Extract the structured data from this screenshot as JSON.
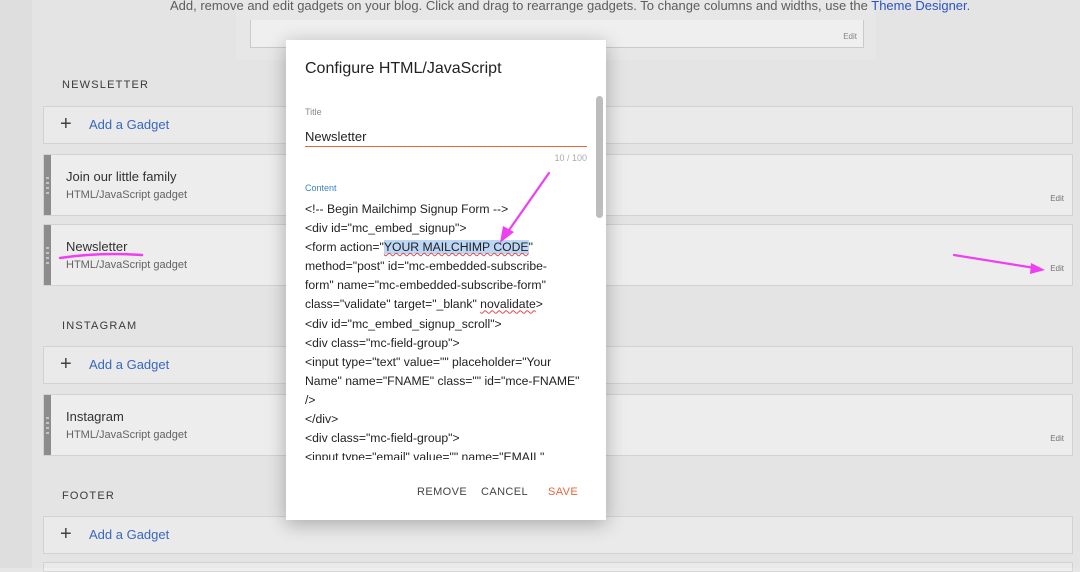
{
  "page": {
    "description": "Add, remove and edit gadgets on your blog. Click and drag to rearrange gadgets. To change columns and widths, use the",
    "theme_link": "Theme Designer",
    "description_end": ".",
    "top_edit": "Edit"
  },
  "sections": {
    "newsletter": {
      "title": "NEWSLETTER",
      "add_gadget": "Add a Gadget",
      "gadgets": [
        {
          "name": "Join our little family",
          "type": "HTML/JavaScript gadget",
          "edit": "Edit"
        },
        {
          "name": "Newsletter",
          "type": "HTML/JavaScript gadget",
          "edit": "Edit"
        }
      ]
    },
    "instagram": {
      "title": "INSTAGRAM",
      "add_gadget": "Add a Gadget",
      "gadgets": [
        {
          "name": "Instagram",
          "type": "HTML/JavaScript gadget",
          "edit": "Edit"
        }
      ]
    },
    "footer": {
      "title": "FOOTER",
      "add_gadget": "Add a Gadget"
    }
  },
  "modal": {
    "title": "Configure HTML/JavaScript",
    "title_label": "Title",
    "title_value": "Newsletter",
    "counter": "10 / 100",
    "content_label": "Content",
    "content_lines": [
      "<!-- Begin Mailchimp Signup Form -->",
      "<div id=\"mc_embed_signup\">",
      "<form action=\"",
      "YOUR MAILCHIMP CODE",
      "\"",
      "method=\"post\" id=\"mc-embedded-subscribe-",
      "form\" name=\"mc-embedded-subscribe-form\"",
      "class=\"validate\" target=\"_blank\" ",
      "novalidate",
      ">",
      "<div id=\"mc_embed_signup_scroll\">",
      "<div class=\"mc-field-group\">",
      "<input type=\"text\" value=\"\" placeholder=\"Your",
      "Name\" name=\"FNAME\" class=\"\" id=\"mce-FNAME\"",
      "/>",
      "</div>",
      "<div class=\"mc-field-group\">",
      "<input type=\"email\" value=\"\" name=\"EMAIL\""
    ],
    "buttons": {
      "remove": "REMOVE",
      "cancel": "CANCEL",
      "save": "SAVE"
    }
  },
  "colors": {
    "accent": "#e4663b",
    "link": "#3b6ac3",
    "annotation": "#ee3ff0",
    "highlight": "#bcd6f5"
  }
}
